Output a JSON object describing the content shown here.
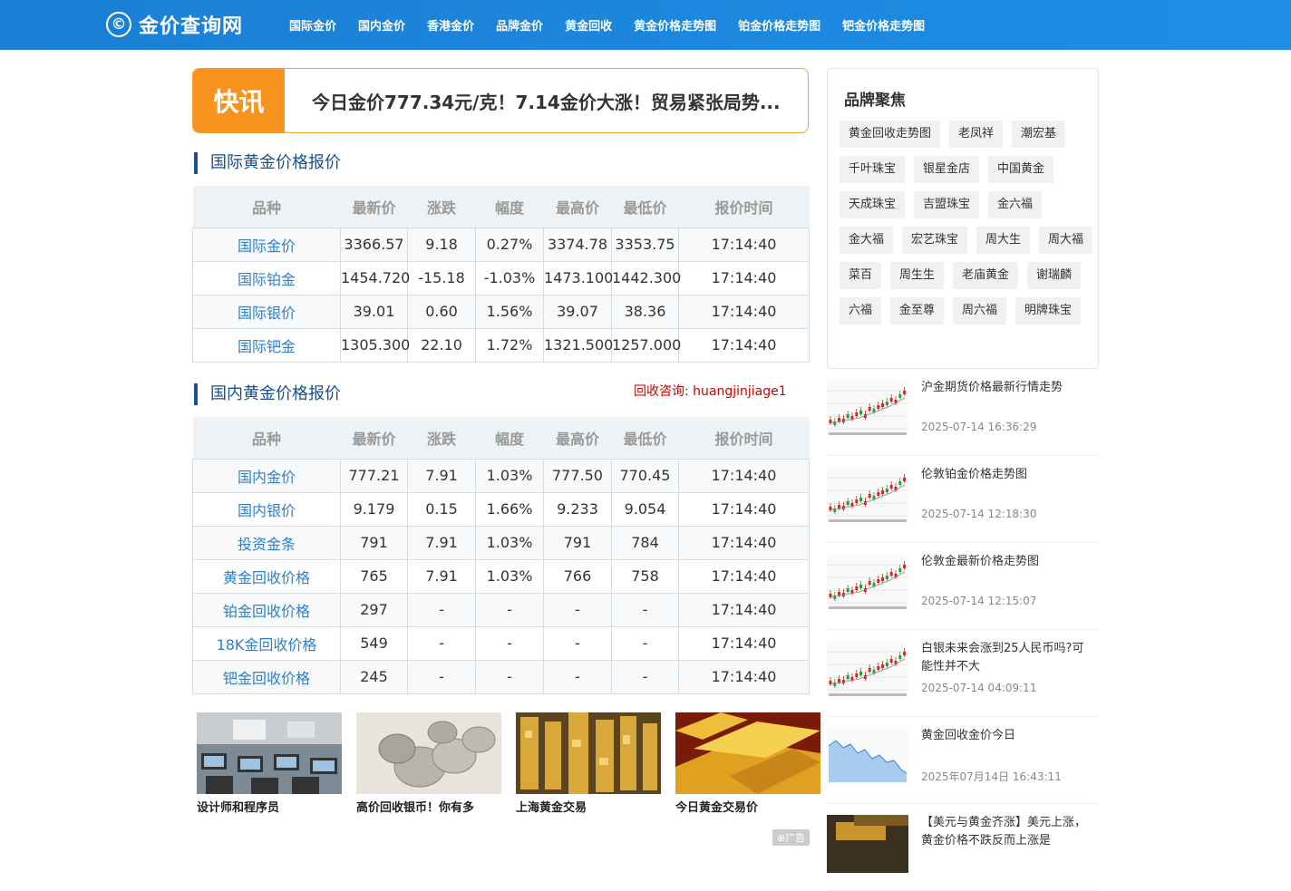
{
  "header": {
    "logo_icon": "©",
    "logo_text": "金价查询网",
    "nav": [
      "国际金价",
      "国内金价",
      "香港金价",
      "品牌金价",
      "黄金回收",
      "黄金价格走势图",
      "铂金价格走势图",
      "钯金价格走势图"
    ]
  },
  "flash": {
    "tag": "快讯",
    "text": "今日金价777.34元/克！7.14金价大涨！贸易紧张局势..."
  },
  "intl": {
    "title": "国际黄金价格报价",
    "headers": [
      "品种",
      "最新价",
      "涨跌",
      "幅度",
      "最高价",
      "最低价",
      "报价时间"
    ],
    "rows": [
      [
        "国际金价",
        "3366.57",
        "9.18",
        "0.27%",
        "3374.78",
        "3353.75",
        "17:14:40"
      ],
      [
        "国际铂金",
        "1454.720",
        "-15.18",
        "-1.03%",
        "1473.100",
        "1442.300",
        "17:14:40"
      ],
      [
        "国际银价",
        "39.01",
        "0.60",
        "1.56%",
        "39.07",
        "38.36",
        "17:14:40"
      ],
      [
        "国际钯金",
        "1305.300",
        "22.10",
        "1.72%",
        "1321.500",
        "1257.000",
        "17:14:40"
      ]
    ]
  },
  "domestic": {
    "title": "国内黄金价格报价",
    "consult": "回收咨询: huangjinjiage1",
    "headers": [
      "品种",
      "最新价",
      "涨跌",
      "幅度",
      "最高价",
      "最低价",
      "报价时间"
    ],
    "rows": [
      [
        "国内金价",
        "777.21",
        "7.91",
        "1.03%",
        "777.50",
        "770.45",
        "17:14:40"
      ],
      [
        "国内银价",
        "9.179",
        "0.15",
        "1.66%",
        "9.233",
        "9.054",
        "17:14:40"
      ],
      [
        "投资金条",
        "791",
        "7.91",
        "1.03%",
        "791",
        "784",
        "17:14:40"
      ],
      [
        "黄金回收价格",
        "765",
        "7.91",
        "1.03%",
        "766",
        "758",
        "17:14:40"
      ],
      [
        "铂金回收价格",
        "297",
        "-",
        "-",
        "-",
        "-",
        "17:14:40"
      ],
      [
        "18K金回收价格",
        "549",
        "-",
        "-",
        "-",
        "-",
        "17:14:40"
      ],
      [
        "钯金回收价格",
        "245",
        "-",
        "-",
        "-",
        "-",
        "17:14:40"
      ]
    ]
  },
  "thumbs": [
    {
      "caption": "设计师和程序员",
      "kind": "classroom"
    },
    {
      "caption": "高价回收银币！你有多",
      "kind": "coins"
    },
    {
      "caption": "上海黄金交易",
      "kind": "shop"
    },
    {
      "caption": "今日黄金交易价",
      "kind": "bars"
    }
  ],
  "ad_badge": "⊗广告",
  "brands": {
    "title": "品牌聚焦",
    "tags": [
      "黄金回收走势图",
      "老凤祥",
      "潮宏基",
      "千叶珠宝",
      "银星金店",
      "中国黄金",
      "天成珠宝",
      "吉盟珠宝",
      "金六福",
      "金大福",
      "宏艺珠宝",
      "周大生",
      "周大福",
      "菜百",
      "周生生",
      "老庙黄金",
      "谢瑞麟",
      "六福",
      "金至尊",
      "周六福",
      "明牌珠宝"
    ]
  },
  "news": [
    {
      "title": "沪金期货价格最新行情走势",
      "date": "2025-07-14 16:36:29",
      "kind": "candle"
    },
    {
      "title": "伦敦铂金价格走势图",
      "date": "2025-07-14 12:18:30",
      "kind": "candle"
    },
    {
      "title": "伦敦金最新价格走势图",
      "date": "2025-07-14 12:15:07",
      "kind": "candle"
    },
    {
      "title": "白银未来会涨到25人民币吗?可能性并不大",
      "date": "2025-07-14 04:09:11",
      "kind": "candle"
    },
    {
      "title": "黄金回收金价今日",
      "date": "2025年07月14日 16:43:11",
      "kind": "area"
    },
    {
      "title": "【美元与黄金齐涨】美元上涨，黄金价格不跌反而上涨是",
      "date": "",
      "kind": "photo"
    }
  ]
}
